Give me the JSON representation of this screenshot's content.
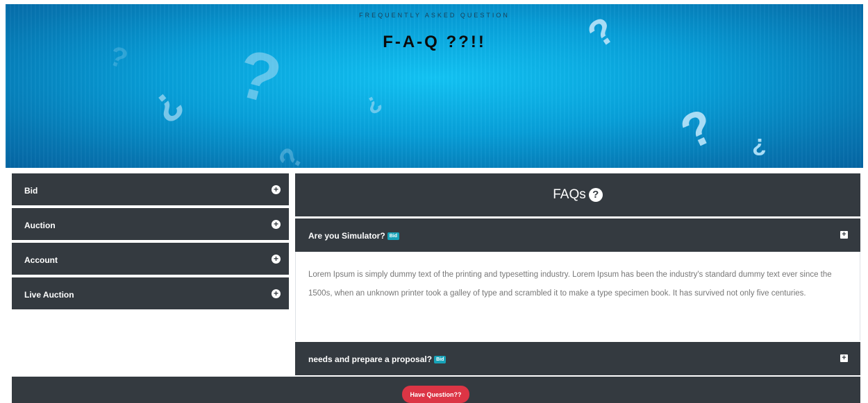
{
  "hero": {
    "subtitle": "FREQUENTLY ASKED QUESTION",
    "title": "F-A-Q ??!!"
  },
  "sidebar": {
    "items": [
      {
        "label": "Bid"
      },
      {
        "label": "Auction"
      },
      {
        "label": "Account"
      },
      {
        "label": "Live Auction"
      }
    ]
  },
  "faq": {
    "heading": "FAQs",
    "items": [
      {
        "question": "Are you Simulator?",
        "badge": "Bid",
        "answer": "Lorem Ipsum is simply dummy text of the printing and typesetting industry. Lorem Ipsum has been the industry's standard dummy text ever since the 1500s, when an unknown printer took a galley of type and scrambled it to make a type specimen book. It has survived not only five centuries."
      },
      {
        "question": "needs and prepare a proposal?",
        "badge": "Bid"
      }
    ]
  },
  "footer": {
    "button_label": "Have Question??"
  },
  "colors": {
    "dark": "#343a40",
    "accent": "#17a2b8",
    "danger": "#dc3545",
    "hero": "#079fd9"
  }
}
